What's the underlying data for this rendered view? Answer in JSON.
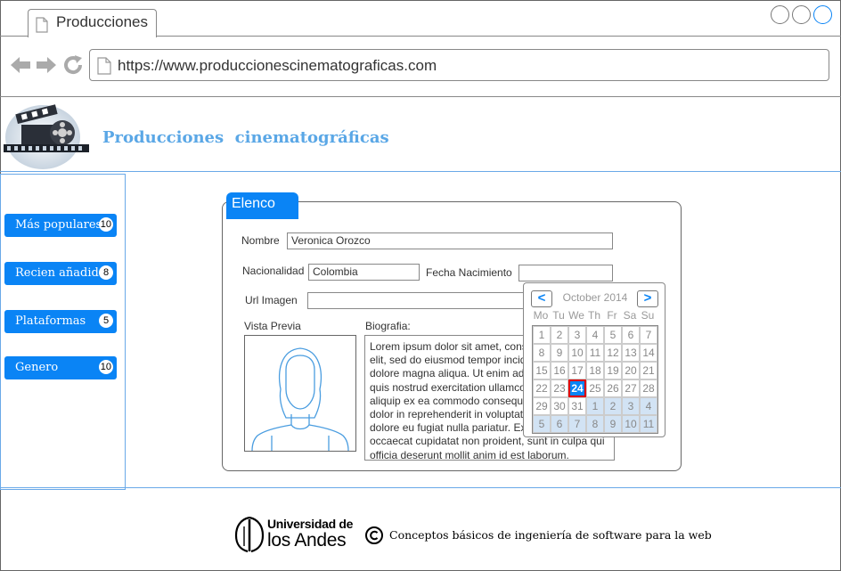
{
  "browser": {
    "tab_title": "Producciones",
    "url": "https://www.produccionescinematograficas.com"
  },
  "header": {
    "title": "Producciones  cinematográficas"
  },
  "sidebar": {
    "items": [
      {
        "label": "Más populares",
        "count": "10"
      },
      {
        "label": "Recien añadida",
        "count": "8"
      },
      {
        "label": "Plataformas",
        "count": "5"
      },
      {
        "label": "Genero",
        "count": "10"
      }
    ]
  },
  "form": {
    "panel_title": "Elenco",
    "name_label": "Nombre",
    "name_value": "Veronica Orozco",
    "nationality_label": "Nacionalidad",
    "nationality_value": "Colombia",
    "birthdate_label": "Fecha Nacimiento",
    "birthdate_value": "",
    "image_url_label": "Url Imagen",
    "image_url_value": "",
    "preview_label": "Vista Previa",
    "bio_label": "Biografia:",
    "bio_text": "Lorem ipsum dolor sit amet, consectetur adipiscing elit, sed do eiusmod tempor incididunt ut labore et dolore magna aliqua. Ut enim ad minim veniam, quis nostrud exercitation ullamco laboris nisi ut aliquip ex ea commodo consequat. Duis aute irure dolor in reprehenderit in voluptate velit esse cillum dolore eu fugiat nulla pariatur. Excepteur sint occaecat cupidatat non proident, sunt in culpa qui officia deserunt mollit anim id est laborum."
  },
  "calendar": {
    "prev": "<",
    "next": ">",
    "month_label": "October 2014",
    "weekdays": [
      "Mo",
      "Tu",
      "We",
      "Th",
      "Fr",
      "Sa",
      "Su"
    ],
    "days": [
      "1",
      "2",
      "3",
      "4",
      "5",
      "6",
      "7",
      "8",
      "9",
      "10",
      "11",
      "12",
      "13",
      "14",
      "15",
      "16",
      "17",
      "18",
      "19",
      "20",
      "21",
      "22",
      "23",
      "24",
      "25",
      "26",
      "27",
      "28",
      "29",
      "30",
      "31",
      "1",
      "2",
      "3",
      "4",
      "5",
      "6",
      "7",
      "8",
      "9",
      "10",
      "11"
    ],
    "selected_day": "24",
    "next_month_start_index": 31,
    "highlight_color": "#0a84f5"
  },
  "footer": {
    "university_line1": "Universidad de",
    "university_line2": "los Andes",
    "copyright_symbol": "©",
    "text": "Conceptos básicos de ingeniería de software para la web"
  },
  "colors": {
    "accent": "#0a84f5",
    "title": "#5aa7e6",
    "selected_border": "#e00000"
  }
}
